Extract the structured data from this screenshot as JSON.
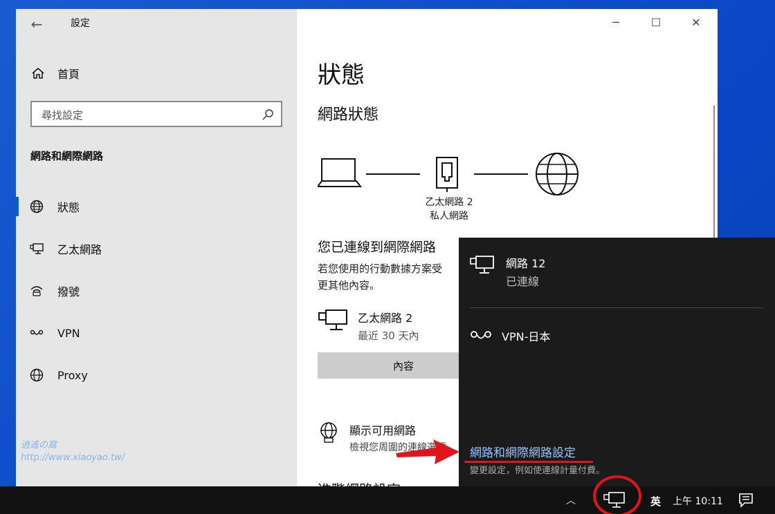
{
  "window": {
    "title": "設定",
    "back": "←",
    "minimize": "─",
    "maximize": "☐",
    "close": "✕"
  },
  "sidebar": {
    "home": "首頁",
    "search_placeholder": "尋找設定",
    "section": "網路和網際網路",
    "items": [
      {
        "label": "狀態",
        "icon": "globe-icon",
        "active": true
      },
      {
        "label": "乙太網路",
        "icon": "ethernet-icon"
      },
      {
        "label": "撥號",
        "icon": "dialup-icon"
      },
      {
        "label": "VPN",
        "icon": "vpn-icon"
      },
      {
        "label": "Proxy",
        "icon": "globe-icon"
      }
    ]
  },
  "main": {
    "title": "狀態",
    "subtitle": "網路狀態",
    "diagram_label_1": "乙太網路 2",
    "diagram_label_2": "私人網路",
    "connected_title": "您已連線到網際網路",
    "connected_desc_1": "若您使用的行動數據方案受",
    "connected_desc_2": "更其他內容。",
    "ethernet_name": "乙太網路 2",
    "ethernet_sub": "最近 30 天內",
    "properties_button": "內容",
    "available_title": "顯示可用網路",
    "available_sub": "檢視您周圍的連線選項",
    "advanced": "進階網路設定"
  },
  "flyout": {
    "network_name": "網路 12",
    "network_status": "已連線",
    "vpn": "VPN-日本",
    "settings_link": "網路和網際網路設定",
    "settings_sub": "變更設定，例如使連線計量付費。"
  },
  "taskbar": {
    "chevron": "︿",
    "ime": "英",
    "time": "上午 10:11"
  },
  "watermark": {
    "line1": "逍遙の窩",
    "line2": "http://www.xiaoyao.tw/"
  }
}
